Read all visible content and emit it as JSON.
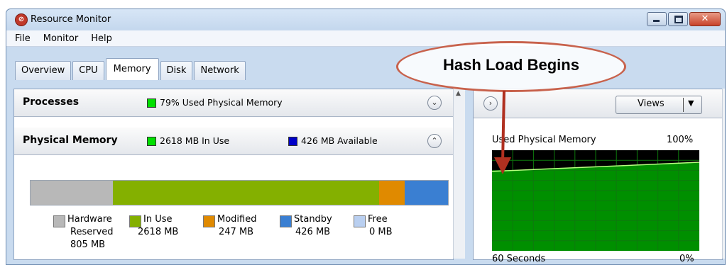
{
  "window": {
    "title": "Resource Monitor"
  },
  "menu": [
    "File",
    "Monitor",
    "Help"
  ],
  "tabs": [
    {
      "label": "Overview",
      "active": false
    },
    {
      "label": "CPU",
      "active": false
    },
    {
      "label": "Memory",
      "active": true
    },
    {
      "label": "Disk",
      "active": false
    },
    {
      "label": "Network",
      "active": false
    }
  ],
  "processes": {
    "title": "Processes",
    "legend_text": "79% Used Physical Memory",
    "legend_color": "#00e000"
  },
  "physical_memory": {
    "title": "Physical Memory",
    "in_use_text": "2618 MB In Use",
    "in_use_color": "#00e000",
    "available_text": "426 MB Available",
    "available_color": "#0000c8",
    "bar": [
      {
        "key": "hardware_reserved",
        "mb": 805,
        "color": "#b8b8b8"
      },
      {
        "key": "in_use",
        "mb": 2618,
        "color": "#84b000"
      },
      {
        "key": "modified",
        "mb": 247,
        "color": "#e08a00"
      },
      {
        "key": "standby",
        "mb": 426,
        "color": "#3a7fd2"
      },
      {
        "key": "free",
        "mb": 0,
        "color": "#b9cff0"
      }
    ],
    "legend": [
      {
        "label": "Hardware",
        "line2": "Reserved",
        "line3": "805 MB",
        "color": "#b8b8b8"
      },
      {
        "label": "In Use",
        "line2": "2618 MB",
        "line3": "",
        "color": "#84b000"
      },
      {
        "label": "Modified",
        "line2": "247 MB",
        "line3": "",
        "color": "#e08a00"
      },
      {
        "label": "Standby",
        "line2": "426 MB",
        "line3": "",
        "color": "#3a7fd2"
      },
      {
        "label": "Free",
        "line2": "0 MB",
        "line3": "",
        "color": "#b9cff0"
      }
    ]
  },
  "right_panel": {
    "views_label": "Views",
    "graph_title": "Used Physical Memory",
    "graph_max": "100%",
    "graph_time": "60 Seconds",
    "graph_min": "0%",
    "graph_fill_color": "#00a800",
    "graph_start_percent": 79,
    "graph_end_percent": 88
  },
  "annotation": {
    "text": "Hash Load Begins",
    "color": "#b03020"
  }
}
